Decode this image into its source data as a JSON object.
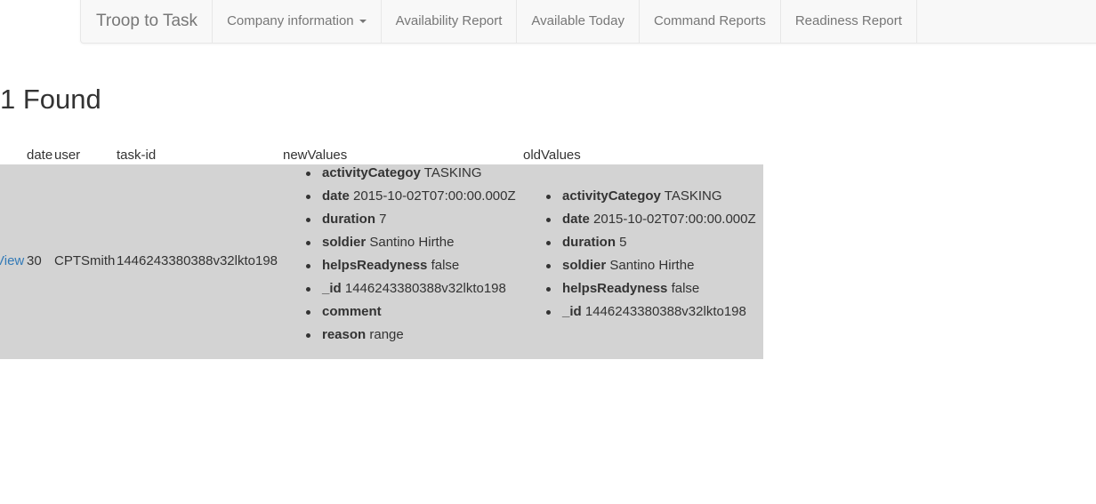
{
  "nav": {
    "brand": "Troop to Task",
    "items": [
      {
        "label": "Company information",
        "dropdown": true
      },
      {
        "label": "Availability Report"
      },
      {
        "label": "Available Today"
      },
      {
        "label": "Command Reports"
      },
      {
        "label": "Readiness Report"
      }
    ]
  },
  "heading": "1 Found",
  "table": {
    "headers": {
      "date": "date",
      "user": "user",
      "task_id": "task-id",
      "new_values": "newValues",
      "old_values": "oldValues"
    },
    "row": {
      "view_link": "View",
      "date": "30",
      "user": "CPTSmith",
      "task_id": "1446243380388v32lkto198",
      "new_values": [
        {
          "key": "activityCategoy",
          "value": "TASKING"
        },
        {
          "key": "date",
          "value": "2015-10-02T07:00:00.000Z"
        },
        {
          "key": "duration",
          "value": "7"
        },
        {
          "key": "soldier",
          "value": "Santino Hirthe"
        },
        {
          "key": "helpsReadyness",
          "value": "false"
        },
        {
          "key": "_id",
          "value": "1446243380388v32lkto198"
        },
        {
          "key": "comment",
          "value": ""
        },
        {
          "key": "reason",
          "value": "range"
        }
      ],
      "old_values": [
        {
          "key": "activityCategoy",
          "value": "TASKING"
        },
        {
          "key": "date",
          "value": "2015-10-02T07:00:00.000Z"
        },
        {
          "key": "duration",
          "value": "5"
        },
        {
          "key": "soldier",
          "value": "Santino Hirthe"
        },
        {
          "key": "helpsReadyness",
          "value": "false"
        },
        {
          "key": "_id",
          "value": "1446243380388v32lkto198"
        }
      ]
    }
  },
  "colors": {
    "row_background": "#d3d3d3",
    "link": "#337ab7",
    "navbar_background": "#f8f8f8"
  }
}
